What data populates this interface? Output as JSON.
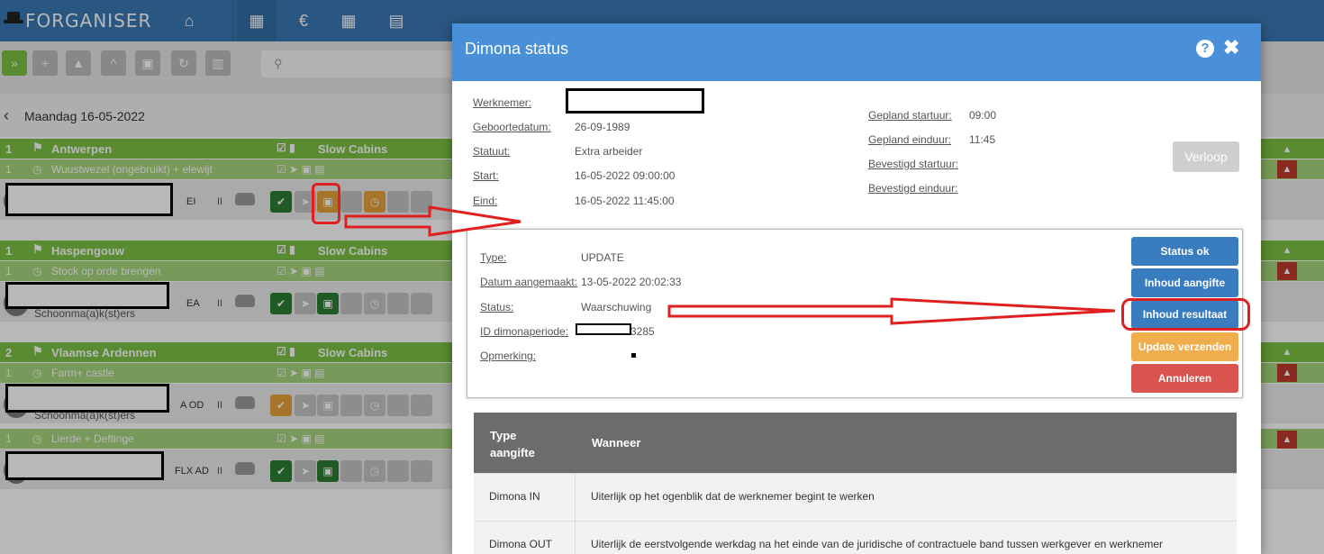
{
  "app": {
    "logo": "FORGANISER"
  },
  "nav": {
    "icons": [
      "home-icon",
      "calendar-icon",
      "euro-icon",
      "grid-icon",
      "document-icon",
      "users-icon",
      "user-icon",
      "user-plus-icon",
      "location-icon",
      "share-icon",
      "sitemap-icon",
      "cubes-icon"
    ],
    "euro_glyph": "€"
  },
  "schedule": {
    "date": "Maandag 16-05-2022",
    "search_placeholder": "",
    "groups": [
      {
        "num": "1",
        "name": "Antwerpen",
        "cabins": "Slow Cabins",
        "sub_num": "1",
        "sub_name": "Wuustwezel (ongebruikt) + elewijt",
        "emp_code": "EI",
        "emp_role": ""
      },
      {
        "num": "1",
        "name": "Haspengouw",
        "cabins": "Slow Cabins",
        "sub_num": "1",
        "sub_name": "Stock op orde brengen",
        "emp_code": "EA",
        "emp_role": "Schoonma(a)k(st)ers"
      },
      {
        "num": "2",
        "name": "Vlaamse Ardennen",
        "cabins": "Slow Cabins",
        "sub_num": "1",
        "sub_name": "Farm+ castle",
        "emp_code": "A OD",
        "emp_role": "Schoonma(a)k(st)ers"
      },
      {
        "num": "1",
        "name": "",
        "cabins": "",
        "sub_num": "1",
        "sub_name": "Lierde + Deftinge",
        "emp_code": "FLX AD",
        "emp_role": ""
      }
    ],
    "pause": "II"
  },
  "modal": {
    "title": "Dimona status",
    "employee": {
      "werknemer_label": "Werknemer:",
      "werknemer_value": "",
      "geboortedatum_label": "Geboortedatum:",
      "geboortedatum_value": "26-09-1989",
      "statuut_label": "Statuut:",
      "statuut_value": "Extra arbeider",
      "start_label": "Start:",
      "start_value": "16-05-2022 09:00:00",
      "eind_label": "Eind:",
      "eind_value": "16-05-2022 11:45:00",
      "gepland_start_label": "Gepland startuur:",
      "gepland_start_value": "09:00",
      "gepland_eind_label": "Gepland einduur:",
      "gepland_eind_value": "11:45",
      "bevestigd_start_label": "Bevestigd startuur:",
      "bevestigd_eind_label": "Bevestigd einduur:"
    },
    "verloop_button": "Verloop",
    "declaration": {
      "type_label": "Type:",
      "type_value": "UPDATE",
      "datum_label": "Datum aangemaakt:",
      "datum_value": "13-05-2022 20:02:33",
      "status_label": "Status:",
      "status_value": "Waarschuwing",
      "id_label": "ID dimonaperiode:",
      "id_value": "3285",
      "opmerking_label": "Opmerking:"
    },
    "buttons": {
      "status_ok": "Status ok",
      "inhoud_aangifte": "Inhoud aangifte",
      "inhoud_resultaat": "Inhoud resultaat",
      "update_verzenden": "Update verzenden",
      "annuleren": "Annuleren"
    },
    "colors": {
      "header": "#4a90d9",
      "blue_button": "#3a7cc0",
      "orange_button": "#f0ad4e",
      "red_button": "#d9534f",
      "annotation": "#e02020"
    },
    "table": {
      "headers": [
        "Type aangifte",
        "Wanneer"
      ],
      "rows": [
        [
          "Dimona IN",
          "Uiterlijk op het ogenblik dat de werknemer begint te werken"
        ],
        [
          "Dimona OUT",
          "Uiterlijk de eerstvolgende werkdag na het einde van de juridische of contractuele band tussen werkgever en werknemer"
        ]
      ]
    }
  }
}
